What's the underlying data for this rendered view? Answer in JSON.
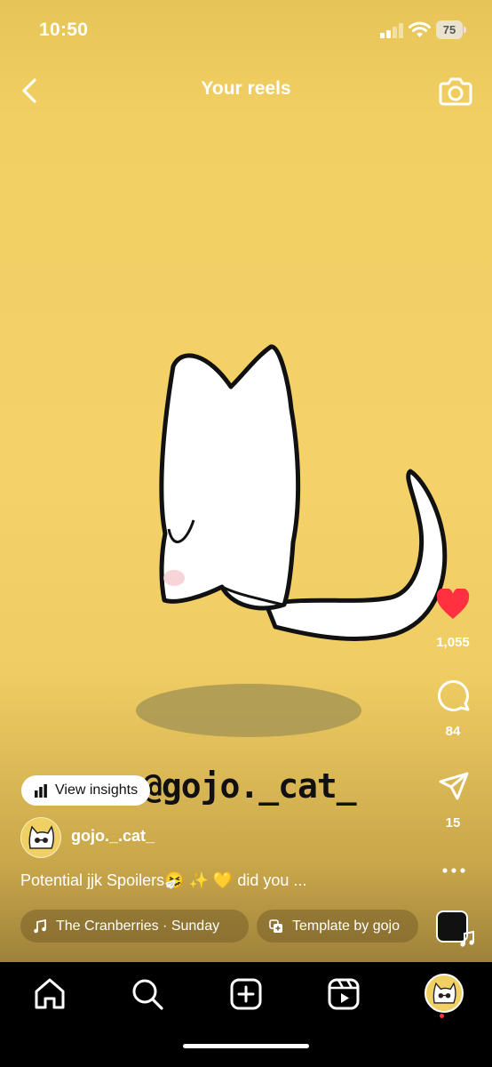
{
  "status_bar": {
    "time": "10:50",
    "battery_level": "75"
  },
  "header": {
    "title": "Your reels"
  },
  "artwork": {
    "watermark": "@gojo._cat_"
  },
  "actions": {
    "likes": "1,055",
    "comments": "84",
    "shares": "15"
  },
  "overlay": {
    "insights_label": "View insights",
    "username": "gojo._.cat_",
    "caption": "Potential jjk Spoilers🤧 ✨ 💛 did you ...",
    "music_label": "The Cranberries · Sunday",
    "template_label": "Template by gojo"
  },
  "colors": {
    "like": "#ff3040",
    "background": "#f4d269"
  }
}
